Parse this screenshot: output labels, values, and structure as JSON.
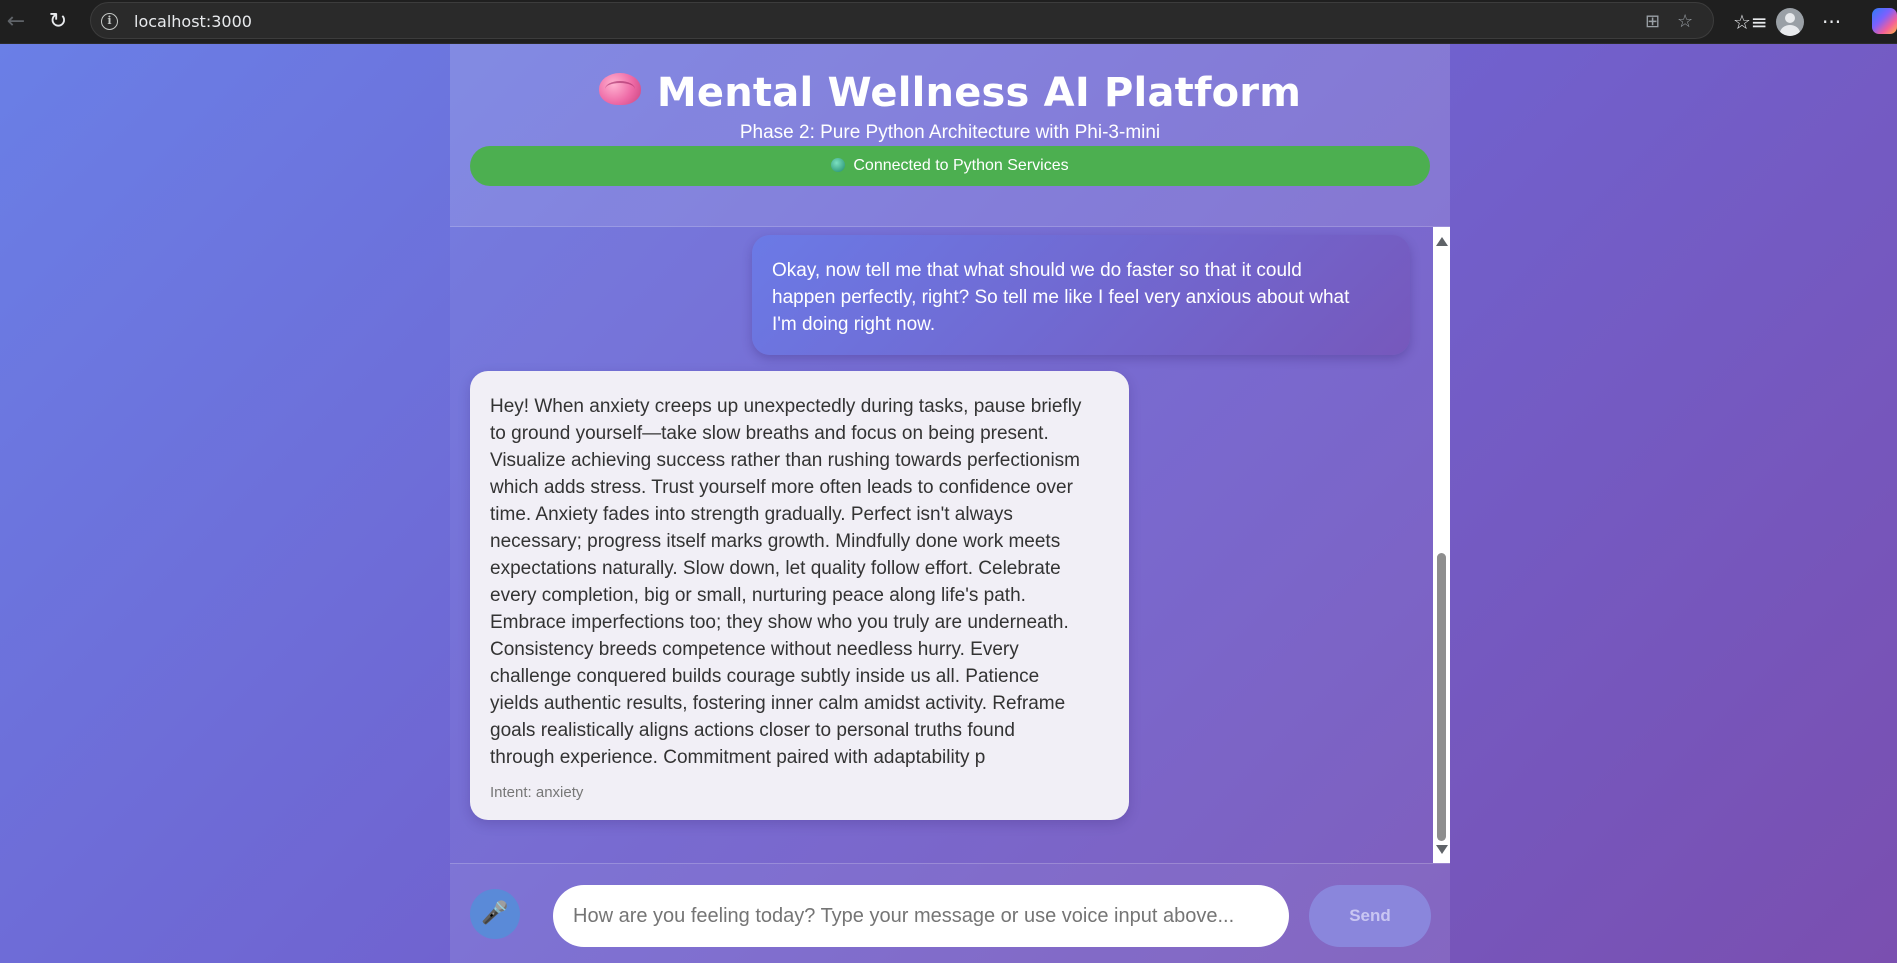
{
  "browser": {
    "url": "localhost:3000",
    "icons": [
      "back-arrow-icon",
      "reload-icon",
      "info-icon",
      "app-available-icon",
      "favorite-star-icon",
      "favorites-list-icon",
      "profile-icon",
      "more-menu-icon",
      "copilot-icon"
    ],
    "back_glyph": "←",
    "reload_glyph": "↻",
    "info_glyph": "i",
    "apps_glyph": "⊞",
    "star_glyph": "☆",
    "favorites_glyph": "☆≡",
    "more_glyph": "···"
  },
  "header": {
    "icon": "brain-icon",
    "title": "Mental Wellness AI Platform",
    "subtitle": "Phase 2: Pure Python Architecture with Phi-3-mini",
    "status": "Connected to Python Services",
    "status_color": "#4caf50"
  },
  "messages": [
    {
      "role": "user",
      "lines": [
        "Okay, now tell me that what should we do faster so that it could",
        "happen perfectly, right? So tell me like I feel very anxious about what",
        "I'm doing right now."
      ]
    },
    {
      "role": "assistant",
      "lines": [
        "Hey! When anxiety creeps up unexpectedly during tasks, pause briefly",
        "to ground yourself—take slow breaths and focus on being present.",
        "Visualize achieving success rather than rushing towards perfectionism",
        "which adds stress. Trust yourself more often leads to confidence over",
        "time. Anxiety fades into strength gradually. Perfect isn't always",
        "necessary; progress itself marks growth. Mindfully done work meets",
        "expectations naturally. Slow down, let quality follow effort. Celebrate",
        "every completion, big or small, nurturing peace along life's path.",
        "Embrace imperfections too; they show who you truly are underneath.",
        "Consistency breeds competence without needless hurry. Every",
        "challenge conquered builds courage subtly inside us all. Patience",
        "yields authentic results, fostering inner calm amidst activity. Reframe",
        "goals realistically aligns actions closer to personal truths found",
        "through experience. Commitment paired with adaptability p"
      ],
      "intent": "Intent: anxiety"
    }
  ],
  "input": {
    "mic_icon": "microphone-icon",
    "mic_glyph": "🎤",
    "placeholder": "How are you feeling today? Type your message or use voice input above...",
    "value": "",
    "send_label": "Send"
  },
  "colors": {
    "background_start": "#6a7fe6",
    "background_end": "#7a4fb0",
    "user_bubble": "#7068d0",
    "assistant_bubble": "#f1eff6",
    "send_button": "#8a86dc"
  }
}
